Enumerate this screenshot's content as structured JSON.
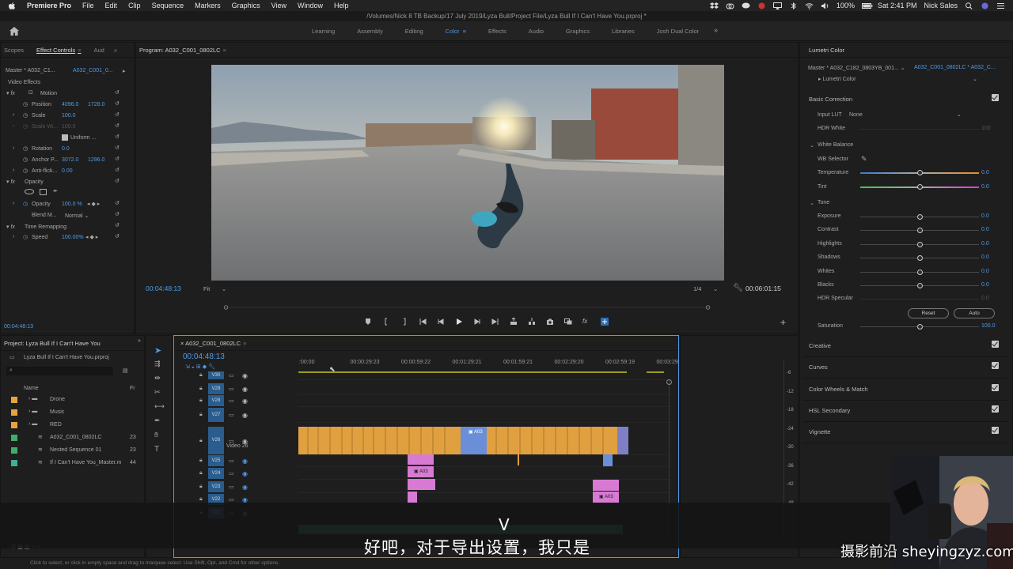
{
  "menubar": {
    "app_name": "Premiere Pro",
    "items": [
      "File",
      "Edit",
      "Clip",
      "Sequence",
      "Markers",
      "Graphics",
      "View",
      "Window",
      "Help"
    ],
    "battery": "100%",
    "clock": "Sat 2:41 PM",
    "user": "Nick Sales"
  },
  "window_title": "/Volumes/Nick 8 TB Backup/17 July 2019/Lyza Bull/Project File/Lyza Bull If I Can't Have You.prproj *",
  "workspaces": {
    "tabs": [
      "Learning",
      "Assembly",
      "Editing",
      "Color",
      "Effects",
      "Audio",
      "Graphics",
      "Libraries",
      "Josh Dual Color"
    ],
    "active": "Color",
    "more": "»"
  },
  "effect_controls": {
    "tabs": [
      "Scopes",
      "Effect Controls",
      "Aud"
    ],
    "master_label": "Master * A032_C1...",
    "clip_label": "A032_C001_0...",
    "section": "Video Effects",
    "motion": "Motion",
    "position_label": "Position",
    "position_x": "4096.0",
    "position_y": "1728.0",
    "scale_label": "Scale",
    "scale_value": "100.0",
    "scale_width_label": "Scale Wi...",
    "scale_width_value": "100.0",
    "uniform_label": "Uniform ...",
    "rotation_label": "Rotation",
    "rotation_value": "0.0",
    "anchor_label": "Anchor P...",
    "anchor_x": "3072.0",
    "anchor_y": "1296.0",
    "antiflicker_label": "Anti-flick...",
    "antiflicker_value": "0.00",
    "opacity_section": "Opacity",
    "opacity_label": "Opacity",
    "opacity_value": "100.0 %",
    "blend_label": "Blend M...",
    "blend_value": "Normal",
    "time_remap": "Time Remapping",
    "speed_label": "Speed",
    "speed_value": "100.00%",
    "timecode": "00:04:48:13"
  },
  "program_monitor": {
    "tab": "Program: A032_C001_0802LC",
    "timecode_left": "00:04:48:13",
    "fit": "Fit",
    "resolution": "1/4",
    "timecode_right": "00:06:01:15"
  },
  "project_panel": {
    "tab": "Project: Lyza Bull If I Can't Have You",
    "file": "Lyza Bull If I Can't Have You.prproj",
    "col_name": "Name",
    "col_fr": "Fr",
    "items": [
      {
        "name": "Drone",
        "fr": "",
        "color": "#e8a33c"
      },
      {
        "name": "Music",
        "fr": "",
        "color": "#e8a33c"
      },
      {
        "name": "RED",
        "fr": "",
        "color": "#e8a33c"
      },
      {
        "name": "A032_C001_0802LC",
        "fr": "23",
        "color": "#3fae6a"
      },
      {
        "name": "Nested Sequence 01",
        "fr": "23",
        "color": "#3fae6a"
      },
      {
        "name": "If I Can't Have You_Master.m",
        "fr": "44",
        "color": "#3fae9a"
      }
    ]
  },
  "timeline": {
    "tab": "A032_C001_0802LC",
    "timecode": "00:04:48:13",
    "ruler": [
      ":00:00",
      "00:00:29:23",
      "00:00:59:22",
      "00:01:29:21",
      "00:01:59:21",
      "00:02:29:20",
      "00:02:59:19",
      "00:03:29:"
    ],
    "tracks": [
      "V30",
      "V29",
      "V28",
      "V27",
      "V26",
      "V25",
      "V24",
      "V23",
      "V22",
      "V21"
    ],
    "track_name": "Video 26",
    "clip_label": "A03",
    "meter_labels": [
      "-6",
      "-12",
      "-18",
      "-24",
      "-30",
      "-36",
      "-42",
      "-48"
    ]
  },
  "lumetri": {
    "panel_title": "Lumetri Color",
    "master_label": "Master * A032_C182_0803YB_001...",
    "clip_label": "A032_C001_0802LC * A032_C...",
    "effect": "Lumetri Color",
    "basic_correction": "Basic Correction",
    "input_lut_label": "Input LUT",
    "input_lut_value": "None",
    "hdr_white_label": "HDR White",
    "hdr_white_value": "100",
    "white_balance": "White Balance",
    "wb_selector": "WB Selector",
    "temperature_label": "Temperature",
    "temperature_value": "0.0",
    "tint_label": "Tint",
    "tint_value": "0.0",
    "tone": "Tone",
    "tone_rows": [
      {
        "label": "Exposure",
        "value": "0.0"
      },
      {
        "label": "Contrast",
        "value": "0.0"
      },
      {
        "label": "Highlights",
        "value": "0.0"
      },
      {
        "label": "Shadows",
        "value": "0.0"
      },
      {
        "label": "Whites",
        "value": "0.0"
      },
      {
        "label": "Blacks",
        "value": "0.0"
      }
    ],
    "hdr_specular_label": "HDR Specular",
    "hdr_specular_value": "0.0",
    "reset_label": "Reset",
    "auto_label": "Auto",
    "saturation_label": "Saturation",
    "saturation_value": "100.0",
    "sections": [
      "Creative",
      "Curves",
      "Color Wheels & Match",
      "HSL Secondary",
      "Vignette"
    ]
  },
  "subtitle": {
    "text": "好吧，对于导出设置，我只是",
    "v_mark": "V"
  },
  "watermark": "摄影前沿 sheyingzyz.com",
  "status_bar": "Click to select, or click in empty space and drag to marquee select. Use Shift, Opt, and Cmd for other options.",
  "colors": {
    "accent_blue": "#4f9be8",
    "clip_orange": "#e8a33c",
    "clip_pink": "#d87ad4",
    "track_blue": "#2a5d8d"
  }
}
